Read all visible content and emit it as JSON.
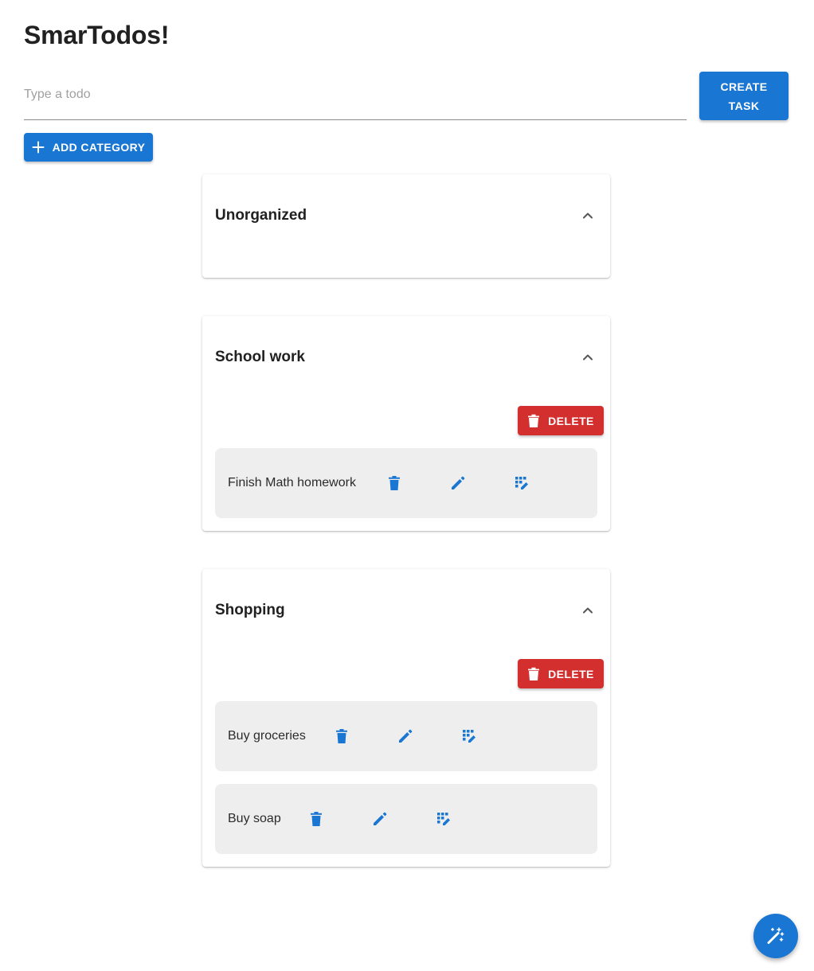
{
  "header": {
    "title": "SmarTodos!"
  },
  "todo_input": {
    "placeholder": "Type a todo",
    "value": ""
  },
  "buttons": {
    "create_task": "CREATE\nTASK",
    "add_category": "ADD CATEGORY",
    "delete": "DELETE"
  },
  "colors": {
    "primary": "#1976d2",
    "danger": "#d32f2f",
    "task_bg": "#eeeeee"
  },
  "categories": [
    {
      "name": "Unorganized",
      "expanded": true,
      "tasks": []
    },
    {
      "name": "School work",
      "expanded": true,
      "tasks": [
        {
          "label": "Finish Math homework"
        }
      ]
    },
    {
      "name": "Shopping",
      "expanded": true,
      "tasks": [
        {
          "label": "Buy groceries"
        },
        {
          "label": "Buy soap"
        }
      ]
    }
  ],
  "icons": {
    "task_actions": [
      "delete-icon",
      "edit-icon",
      "grid-edit-icon"
    ],
    "category_toggle": "chevron-up-icon",
    "add": "plus-icon",
    "fab": "magic-wand-icon"
  }
}
